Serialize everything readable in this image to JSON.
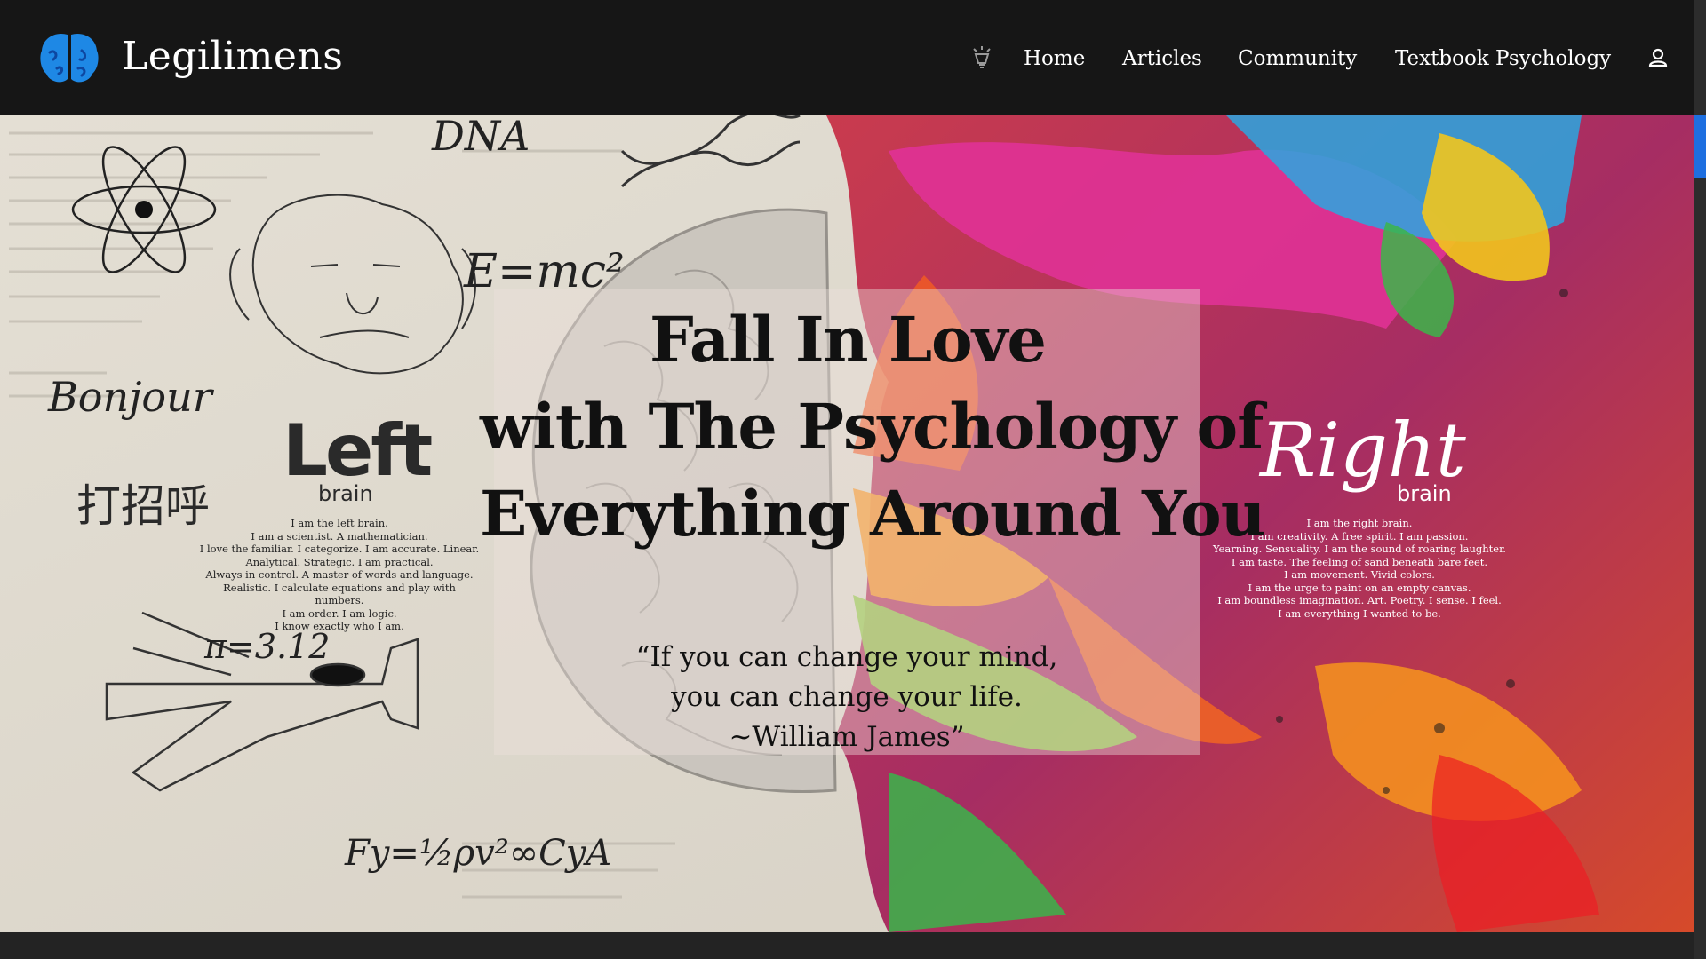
{
  "header": {
    "brand": "Legilimens",
    "brand_color": "#1e88e5",
    "logo_icon": "brain-icon",
    "nav": {
      "lamp_icon": "lamp-icon",
      "items": [
        "Home",
        "Articles",
        "Community",
        "Textbook Psychology"
      ],
      "user_icon": "user-icon"
    }
  },
  "hero": {
    "headline": [
      "Fall In Love",
      "with The Psychology of",
      "Everything Around You"
    ],
    "quote": [
      "“If you can change your mind,",
      "you can change your life.",
      "~William James”"
    ],
    "art": {
      "left_title": "Left",
      "left_subtitle": "brain",
      "left_text": "I am the left brain.\nI am a scientist. A mathematician.\nI love the familiar. I categorize. I am accurate. Linear.\nAnalytical. Strategic. I am practical.\nAlways in control. A master of words and language.\nRealistic. I calculate equations and play with numbers.\nI am order. I am logic.\nI know exactly who I am.",
      "right_title": "Right",
      "right_subtitle": "brain",
      "right_text": "I am the right brain.\nI am creativity. A free spirit. I am passion.\nYearning. Sensuality. I am the sound of roaring laughter.\nI am taste. The feeling of sand beneath bare feet.\nI am movement. Vivid colors.\nI am the urge to paint on an empty canvas.\nI am boundless imagination. Art. Poetry. I sense. I feel.\nI am everything I wanted to be.",
      "dna": "DNA",
      "emc2": "E=mc²",
      "bonjour": "Bonjour",
      "chinese": "打招呼",
      "pi": "π=3.12",
      "formula": "Fy=½ρv²∞CyA"
    }
  }
}
